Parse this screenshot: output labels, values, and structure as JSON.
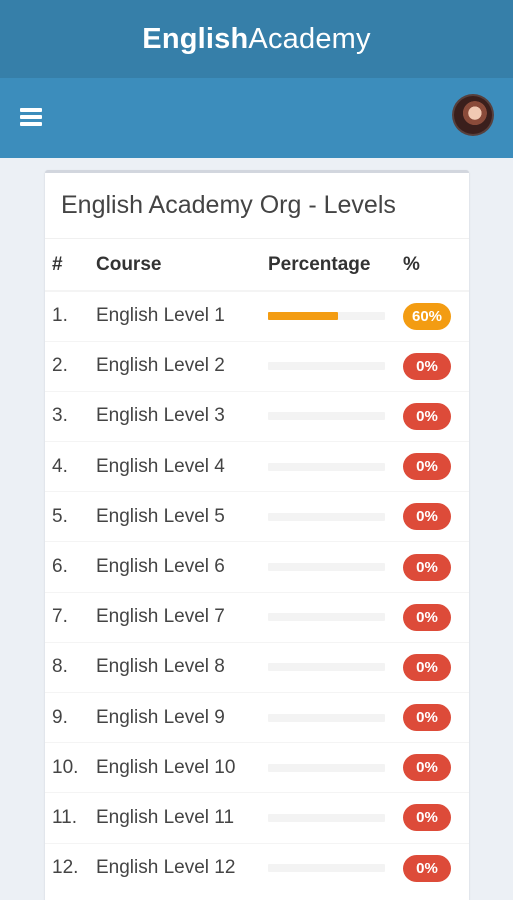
{
  "header": {
    "logo_bold": "English",
    "logo_light": "Academy"
  },
  "navbar": {
    "menu_icon": "hamburger-icon",
    "avatar_icon": "user-avatar"
  },
  "box": {
    "title": "English Academy Org - Levels",
    "columns": [
      "#",
      "Course",
      "Percentage",
      "%"
    ],
    "rows": [
      {
        "num": "1.",
        "course": "English Level 1",
        "progress": 0.6,
        "badge": "60%",
        "badge_color": "#f39c12"
      },
      {
        "num": "2.",
        "course": "English Level 2",
        "progress": 0,
        "badge": "0%",
        "badge_color": "#dd4b39"
      },
      {
        "num": "3.",
        "course": "English Level 3",
        "progress": 0,
        "badge": "0%",
        "badge_color": "#dd4b39"
      },
      {
        "num": "4.",
        "course": "English Level 4",
        "progress": 0,
        "badge": "0%",
        "badge_color": "#dd4b39"
      },
      {
        "num": "5.",
        "course": "English Level 5",
        "progress": 0,
        "badge": "0%",
        "badge_color": "#dd4b39"
      },
      {
        "num": "6.",
        "course": "English Level 6",
        "progress": 0,
        "badge": "0%",
        "badge_color": "#dd4b39"
      },
      {
        "num": "7.",
        "course": "English Level 7",
        "progress": 0,
        "badge": "0%",
        "badge_color": "#dd4b39"
      },
      {
        "num": "8.",
        "course": "English Level 8",
        "progress": 0,
        "badge": "0%",
        "badge_color": "#dd4b39"
      },
      {
        "num": "9.",
        "course": "English Level 9",
        "progress": 0,
        "badge": "0%",
        "badge_color": "#dd4b39"
      },
      {
        "num": "10.",
        "course": "English Level 10",
        "progress": 0,
        "badge": "0%",
        "badge_color": "#dd4b39"
      },
      {
        "num": "11.",
        "course": "English Level 11",
        "progress": 0,
        "badge": "0%",
        "badge_color": "#dd4b39"
      },
      {
        "num": "12.",
        "course": "English Level 12",
        "progress": 0,
        "badge": "0%",
        "badge_color": "#dd4b39"
      }
    ]
  },
  "colors": {
    "topbar": "#367fa9",
    "navbar": "#3c8dbc",
    "background": "#ecf0f5",
    "progress_fill": "#f39c12",
    "badge_warning": "#f39c12",
    "badge_danger": "#dd4b39"
  }
}
